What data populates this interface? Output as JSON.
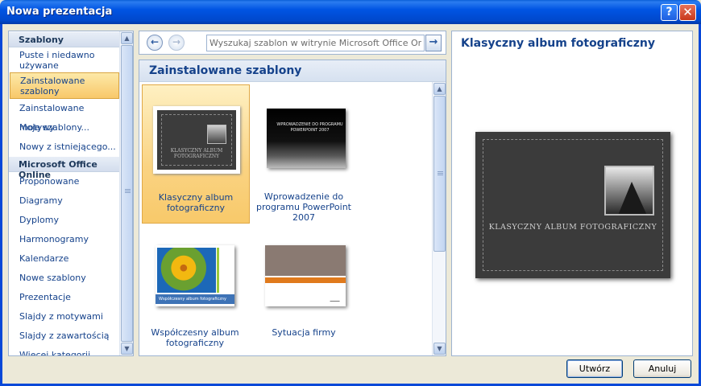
{
  "window": {
    "title": "Nowa prezentacja",
    "help_glyph": "?",
    "close_glyph": "✕"
  },
  "sidebar": {
    "sections": [
      {
        "header": "Szablony",
        "items": [
          {
            "label": "Puste i niedawno używane",
            "selected": false
          },
          {
            "label": "Zainstalowane szablony",
            "selected": true
          },
          {
            "label": "Zainstalowane motywy",
            "selected": false
          },
          {
            "label": "Moje szablony...",
            "selected": false
          },
          {
            "label": "Nowy z istniejącego...",
            "selected": false
          }
        ]
      },
      {
        "header": "Microsoft Office Online",
        "items": [
          {
            "label": "Proponowane"
          },
          {
            "label": "Diagramy"
          },
          {
            "label": "Dyplomy"
          },
          {
            "label": "Harmonogramy"
          },
          {
            "label": "Kalendarze"
          },
          {
            "label": "Nowe szablony"
          },
          {
            "label": "Prezentacje"
          },
          {
            "label": "Slajdy z motywami"
          },
          {
            "label": "Slajdy z zawartością"
          },
          {
            "label": "Więcej kategorii"
          }
        ]
      }
    ]
  },
  "nav": {
    "back_glyph": "←",
    "forward_glyph": "→",
    "search_placeholder": "Wyszukaj szablon w witrynie Microsoft Office Online",
    "go_glyph": "→"
  },
  "gallery": {
    "header": "Zainstalowane szablony",
    "templates": [
      {
        "label": "Klasyczny album fotograficzny",
        "selected": true,
        "thumb_caption": "KLASYCZNY ALBUM FOTOGRAFICZNY"
      },
      {
        "label": "Wprowadzenie do programu PowerPoint 2007",
        "selected": false,
        "thumb_caption": "WPROWADZENIE DO PROGRAMU POWERPOINT 2007"
      },
      {
        "label": "Współczesny album fotograficzny",
        "selected": false,
        "thumb_caption": "Współczesny album fotograficzny"
      },
      {
        "label": "Sytuacja firmy",
        "selected": false
      }
    ]
  },
  "preview": {
    "title": "Klasyczny album fotograficzny",
    "slide_caption": "KLASYCZNY ALBUM FOTOGRAFICZNY"
  },
  "buttons": {
    "create": "Utwórz",
    "cancel": "Anuluj"
  },
  "colors": {
    "titlebar": "#0054e3",
    "selection": "#f8c86a",
    "link_text": "#15428b",
    "panel_border": "#9db3d1"
  }
}
